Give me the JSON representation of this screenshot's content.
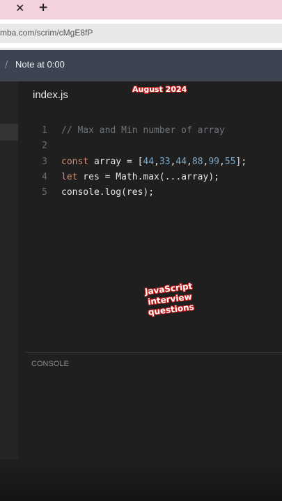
{
  "browser": {
    "tab_close_glyph": "✕",
    "new_tab_glyph": "+",
    "url": "mba.com/scrim/cMgE8fP"
  },
  "toolbar": {
    "separator": "/",
    "note_label": "Note at 0:00"
  },
  "editor": {
    "filename": "index.js",
    "lines": [
      {
        "n": "1"
      },
      {
        "n": "2"
      },
      {
        "n": "3"
      },
      {
        "n": "4"
      },
      {
        "n": "5"
      }
    ]
  },
  "console": {
    "label": "CONSOLE"
  },
  "overlay": {
    "date": "August 2024",
    "title": "JavaScript interview questions"
  },
  "colors": {
    "tab_bar": "#f3d2e0",
    "toolbar": "#3b4450",
    "editor_bg": "#1f1f1f",
    "keyword": "#d58a6e",
    "number": "#7aa7c7",
    "comment": "#6f747a",
    "overlay_outline": "#c41a1a"
  }
}
